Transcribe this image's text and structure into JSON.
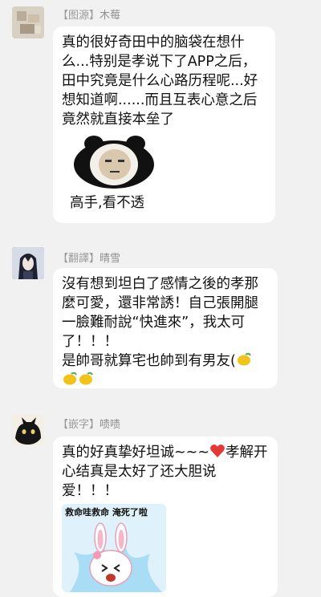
{
  "messages": [
    {
      "role_tag": "【图源】",
      "name": "木莓",
      "text": "真的很好奇田中的脑袋在想什么...特别是孝说下了APP之后，田中究竟是什么心路历程呢...好想知道啊......而且互表心意之后竟然就直接本垒了",
      "sticker_caption": "高手,看不透"
    },
    {
      "role_tag": "【翻譯】",
      "name": "晴雪",
      "text": "沒有想到坦白了感情之後的孝那麼可愛，還非常誘！自己張開腿一臉難耐說“快進來”，我太可了！！！",
      "text2": "是帥哥就算宅也帥到有男友("
    },
    {
      "role_tag": "【嵌字】",
      "name": "啧啧",
      "text_before_heart": "真的好真挚好坦诚~~~",
      "text_after_heart": "孝解开心结真是太好了还大胆说爱！！！",
      "sticker_caption": "救命哇救命 淹死了啦"
    }
  ],
  "colors": {
    "background": "#f1f1f1",
    "bubble": "#ffffff",
    "name": "#8f8f8f",
    "heart": "#e53935",
    "lemon": "#f2c318"
  },
  "icons": [
    "avatar-blurred",
    "avatar-anime",
    "avatar-cat",
    "panda-meme-sticker",
    "lemon-emoji",
    "heart-emoji",
    "bunny-meme-sticker"
  ]
}
